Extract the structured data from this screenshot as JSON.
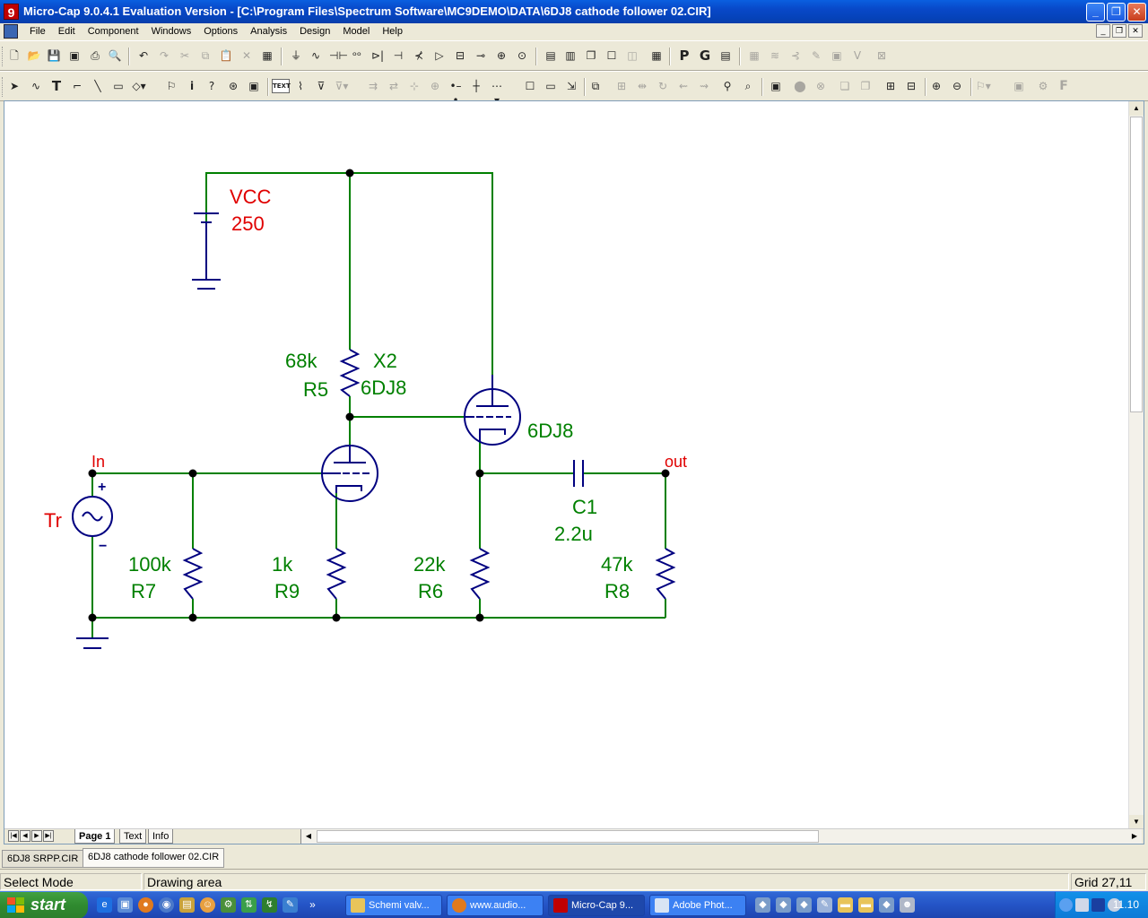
{
  "window": {
    "title": "Micro-Cap 9.0.4.1 Evaluation Version - [C:\\Program Files\\Spectrum Software\\MC9DEMO\\DATA\\6DJ8 cathode follower 02.CIR]",
    "app_icon_glyph": "9"
  },
  "menu": [
    "File",
    "Edit",
    "Component",
    "Windows",
    "Options",
    "Analysis",
    "Design",
    "Model",
    "Help"
  ],
  "toolbar2": {
    "text_button": "TEXT"
  },
  "schematic": {
    "wire_color": "#008000",
    "component_color": "#000080",
    "label_red": "#e00000",
    "label_green": "#008000",
    "vcc": {
      "name": "VCC",
      "value": "250"
    },
    "source": {
      "name": "Tr",
      "plus": "+",
      "minus": "−"
    },
    "nodes": {
      "in": "In",
      "out": "out"
    },
    "r5": {
      "value": "68k",
      "name": "R5"
    },
    "r7": {
      "value": "100k",
      "name": "R7"
    },
    "r9": {
      "value": "1k",
      "name": "R9"
    },
    "r6": {
      "value": "22k",
      "name": "R6"
    },
    "r8": {
      "value": "47k",
      "name": "R8"
    },
    "c1": {
      "name": "C1",
      "value": "2.2u"
    },
    "x2": {
      "name": "X2",
      "model": "6DJ8"
    },
    "tube2_label": "6DJ8"
  },
  "page_tabs": [
    "Page 1",
    "Text",
    "Info"
  ],
  "doc_tabs": [
    "6DJ8 SRPP.CIR",
    "6DJ8 cathode follower 02.CIR"
  ],
  "status": {
    "mode": "Select Mode",
    "area": "Drawing area",
    "grid": "Grid 27,11"
  },
  "taskbar": {
    "start": "start",
    "tasks": [
      "Schemi valv...",
      "www.audio...",
      "Micro-Cap 9...",
      "Adobe Phot..."
    ],
    "clock": "11.10"
  }
}
